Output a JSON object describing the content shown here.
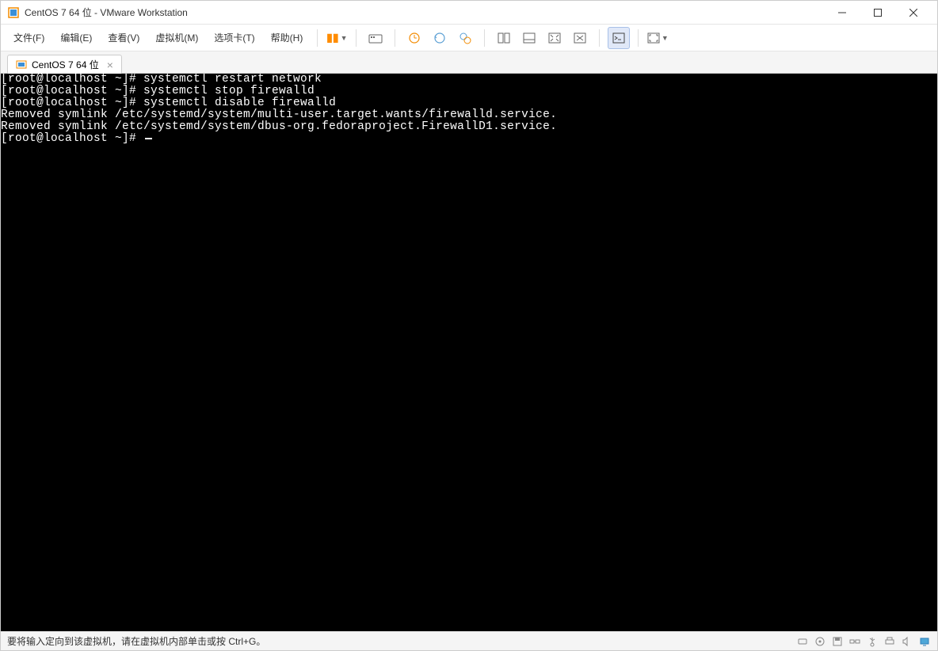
{
  "titlebar": {
    "title": "CentOS 7 64 位 - VMware Workstation"
  },
  "menu": {
    "file": "文件(F)",
    "edit": "编辑(E)",
    "view": "查看(V)",
    "vm": "虚拟机(M)",
    "tabs": "选项卡(T)",
    "help": "帮助(H)"
  },
  "tab": {
    "label": "CentOS 7 64 位"
  },
  "terminal": {
    "lines": [
      "[root@localhost ~]# systemctl restart network",
      "[root@localhost ~]# systemctl stop firewalld",
      "[root@localhost ~]# systemctl disable firewalld",
      "Removed symlink /etc/systemd/system/multi-user.target.wants/firewalld.service.",
      "Removed symlink /etc/systemd/system/dbus-org.fedoraproject.FirewallD1.service.",
      "[root@localhost ~]# "
    ]
  },
  "statusbar": {
    "text": "要将输入定向到该虚拟机，请在虚拟机内部单击或按 Ctrl+G。"
  }
}
